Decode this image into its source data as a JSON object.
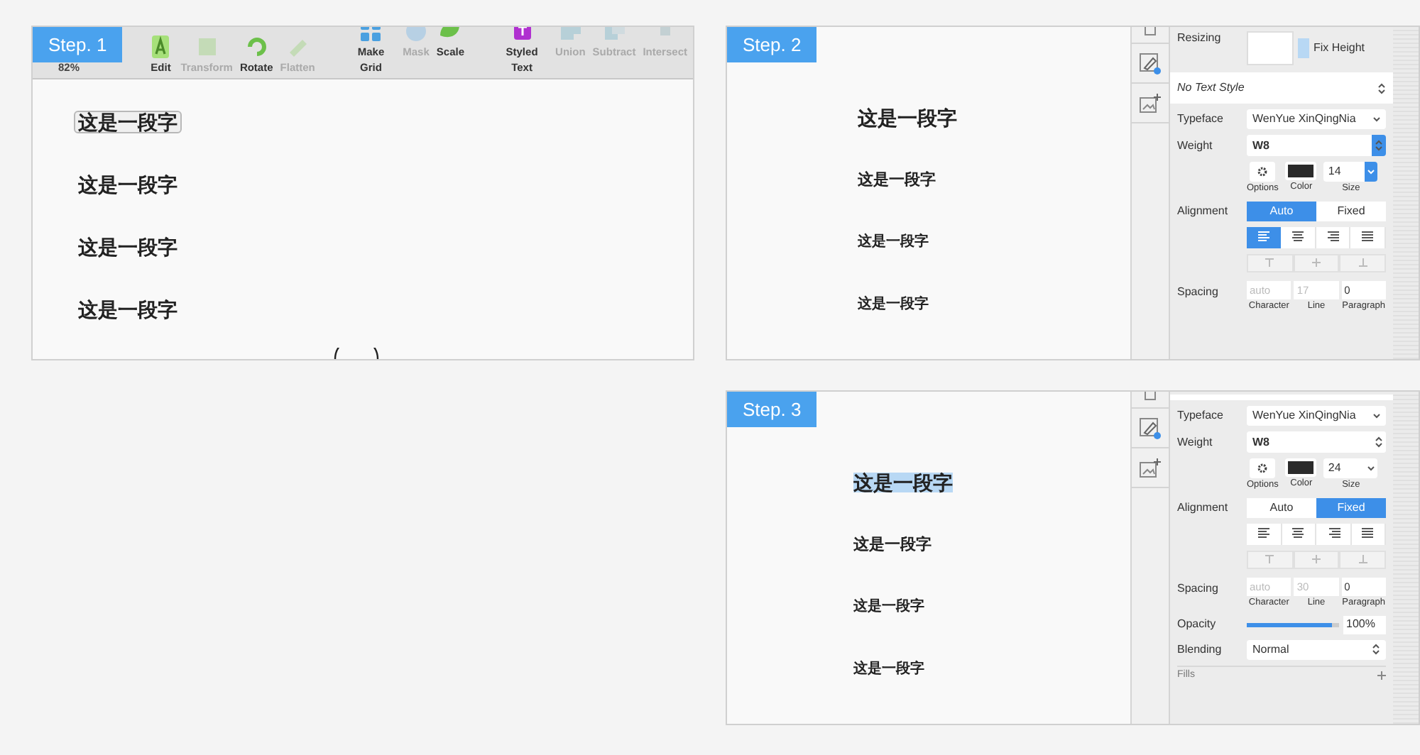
{
  "step1": {
    "badge": "Step. 1",
    "zoom": "82%",
    "tool_groups": [
      [
        {
          "label": "Edit",
          "kind": "edit",
          "disabled": false
        },
        {
          "label": "Transform",
          "kind": "transform",
          "disabled": true
        },
        {
          "label": "Rotate",
          "kind": "rotate",
          "disabled": false
        },
        {
          "label": "Flatten",
          "kind": "flatten",
          "disabled": true
        }
      ],
      [
        {
          "label": "Make Grid",
          "kind": "grid",
          "disabled": false
        },
        {
          "label": "Mask",
          "kind": "mask",
          "disabled": true
        },
        {
          "label": "Scale",
          "kind": "scale",
          "disabled": false
        }
      ],
      [
        {
          "label": "Styled Text",
          "kind": "styled",
          "disabled": false
        },
        {
          "label": "Union",
          "kind": "union",
          "disabled": true
        },
        {
          "label": "Subtract",
          "kind": "subtract",
          "disabled": true
        },
        {
          "label": "Intersect",
          "kind": "intersect",
          "disabled": true
        }
      ]
    ],
    "texts": [
      {
        "text": "这是一段字",
        "selected": true
      },
      {
        "text": "这是一段字",
        "selected": false
      },
      {
        "text": "这是一段字",
        "selected": false
      },
      {
        "text": "这是一段字",
        "selected": false
      }
    ]
  },
  "step2": {
    "badge": "Step. 2",
    "texts": [
      {
        "text": "这是一段字",
        "selected": false
      },
      {
        "text": "这是一段字",
        "selected": false
      },
      {
        "text": "这是一段字",
        "selected": false
      },
      {
        "text": "这是一段字",
        "selected": false
      }
    ],
    "inspector": {
      "resizing": {
        "label": "Resizing",
        "option": "Fix Height"
      },
      "text_style": "No Text Style",
      "typeface": {
        "label": "Typeface",
        "value": "WenYue XinQingNia"
      },
      "weight": {
        "label": "Weight",
        "value": "W8",
        "active": true
      },
      "size": {
        "options": "Options",
        "color_label": "Color",
        "value": "14",
        "label": "Size",
        "active": true
      },
      "alignment": {
        "label": "Alignment",
        "modes": [
          {
            "label": "Auto",
            "selected": true
          },
          {
            "label": "Fixed",
            "selected": false
          }
        ],
        "align": [
          {
            "kind": "left",
            "selected": true
          },
          {
            "kind": "center",
            "selected": false
          },
          {
            "kind": "right",
            "selected": false
          },
          {
            "kind": "justify",
            "selected": false
          }
        ]
      },
      "spacing": {
        "label": "Spacing",
        "fields": [
          {
            "label": "Character",
            "placeholder": "auto"
          },
          {
            "label": "Line",
            "placeholder": "17"
          },
          {
            "label": "Paragraph",
            "value": "0"
          }
        ]
      }
    }
  },
  "step3": {
    "badge": "Step. 3",
    "texts": [
      {
        "text": "这是一段字",
        "selected": true
      },
      {
        "text": "这是一段字",
        "selected": false
      },
      {
        "text": "这是一段字",
        "selected": false
      },
      {
        "text": "这是一段字",
        "selected": false
      }
    ],
    "inspector": {
      "typeface": {
        "label": "Typeface",
        "value": "WenYue XinQingNia"
      },
      "weight": {
        "label": "Weight",
        "value": "W8",
        "active": false
      },
      "size": {
        "options": "Options",
        "color_label": "Color",
        "value": "24",
        "label": "Size",
        "active": false
      },
      "alignment": {
        "label": "Alignment",
        "modes": [
          {
            "label": "Auto",
            "selected": false
          },
          {
            "label": "Fixed",
            "selected": true
          }
        ],
        "align": [
          {
            "kind": "left",
            "selected": false
          },
          {
            "kind": "center",
            "selected": false
          },
          {
            "kind": "right",
            "selected": false
          },
          {
            "kind": "justify",
            "selected": false
          }
        ]
      },
      "spacing": {
        "label": "Spacing",
        "fields": [
          {
            "label": "Character",
            "placeholder": "auto"
          },
          {
            "label": "Line",
            "placeholder": "30"
          },
          {
            "label": "Paragraph",
            "value": "0"
          }
        ]
      },
      "opacity": {
        "label": "Opacity",
        "level": 0.93,
        "value": "100%"
      },
      "blending": {
        "label": "Blending",
        "value": "Normal"
      },
      "fills": {
        "label": "Fills"
      }
    }
  }
}
